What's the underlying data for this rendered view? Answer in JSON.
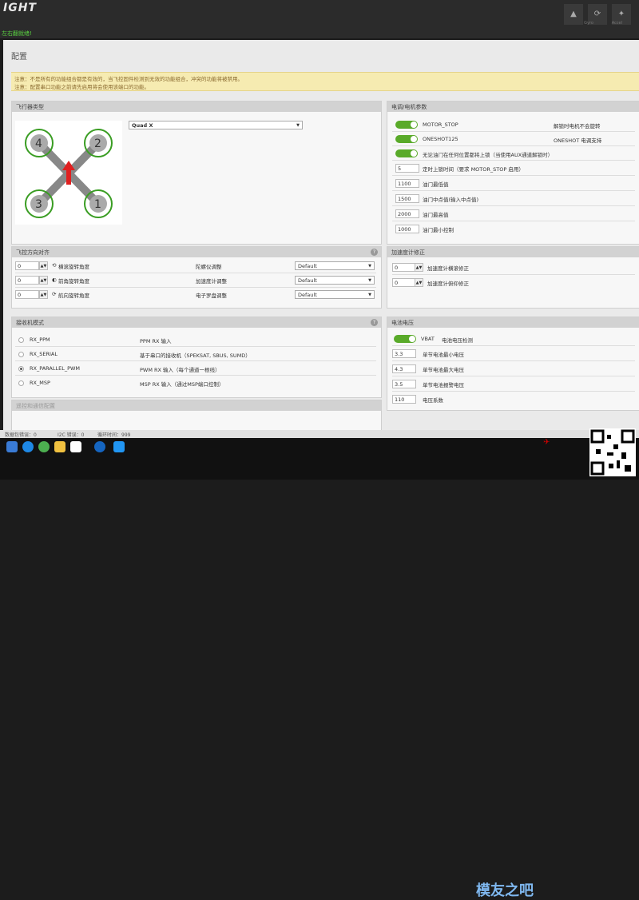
{
  "app": {
    "logo": "IGHT",
    "status": "左右翻就绪!"
  },
  "top_icons": [
    "device-icon",
    "gyro-icon",
    "accel-icon"
  ],
  "top_labels": {
    "gyro": "Gyro",
    "accel": "Accel"
  },
  "page": {
    "title": "配置"
  },
  "notice": [
    "注意：不是所有的功能组合都是有效的，当飞控固件检测到无效的功能组合，冲突的功能将被禁用。",
    "注意：配置串口功能之前请先启用将会使用该端口的功能。"
  ],
  "frame": {
    "title": "飞行器类型",
    "selected": "Quad X",
    "motors": [
      "4",
      "2",
      "3",
      "1"
    ]
  },
  "esc": {
    "title": "电调/电机参数",
    "toggles": [
      {
        "name": "MOTOR_STOP",
        "desc": "解锁时电机不会旋转"
      },
      {
        "name": "ONESHOT125",
        "desc": "ONESHOT 电调支持"
      },
      {
        "name": "无论油门在任何位置都将上锁（当使用AUX通道解锁时）",
        "desc": ""
      }
    ],
    "fields": [
      {
        "value": "5",
        "label": "定时上锁时间（要求 MOTOR_STOP 启用）"
      },
      {
        "value": "1100",
        "label": "油门最低值"
      },
      {
        "value": "1500",
        "label": "油门中点值(输入中点值)"
      },
      {
        "value": "2000",
        "label": "油门最高值"
      },
      {
        "value": "1000",
        "label": "油门最小控制"
      }
    ]
  },
  "alignment": {
    "title": "飞控方向对齐",
    "rows": [
      {
        "value": "0",
        "label": "横滚旋转角度",
        "sensor": "陀螺仪调整",
        "option": "Default"
      },
      {
        "value": "0",
        "label": "前角旋转角度",
        "sensor": "加速度计调整",
        "option": "Default"
      },
      {
        "value": "0",
        "label": "航向旋转角度",
        "sensor": "电子罗盘调整",
        "option": "Default"
      }
    ]
  },
  "acc_trim": {
    "title": "加速度计修正",
    "rows": [
      {
        "value": "0",
        "label": "加速度计横滚修正"
      },
      {
        "value": "0",
        "label": "加速度计俯仰修正"
      }
    ]
  },
  "receiver": {
    "title": "接收机模式",
    "modes": [
      {
        "name": "RX_PPM",
        "desc": "PPM RX 输入",
        "selected": false
      },
      {
        "name": "RX_SERIAL",
        "desc": "基于串口的接收机（SPEKSAT, SBUS, SUMD）",
        "selected": false
      },
      {
        "name": "RX_PARALLEL_PWM",
        "desc": "PWM RX 输入（每个通道一根线）",
        "selected": true
      },
      {
        "name": "RX_MSP",
        "desc": "MSP RX 输入（通过MSP端口控制）",
        "selected": false
      }
    ]
  },
  "battery": {
    "title": "电池电压",
    "toggle": {
      "name": "VBAT",
      "desc": "电池电压检测"
    },
    "fields": [
      {
        "value": "3.3",
        "label": "单节电池最小电压"
      },
      {
        "value": "4.3",
        "label": "单节电池最大电压"
      },
      {
        "value": "3.5",
        "label": "单节电池报警电压"
      },
      {
        "value": "110",
        "label": "电压系数"
      }
    ]
  },
  "next_panel": {
    "title": "遥控和通信配置"
  },
  "footer": {
    "packet": "数据包错误：0",
    "i2c": "I2C 错误：0",
    "cycle": "循环时间：999"
  },
  "watermark": "模友之吧",
  "colors": {
    "green": "#59aa29",
    "notice": "#f6ebb1",
    "header": "#d2d2d2"
  }
}
